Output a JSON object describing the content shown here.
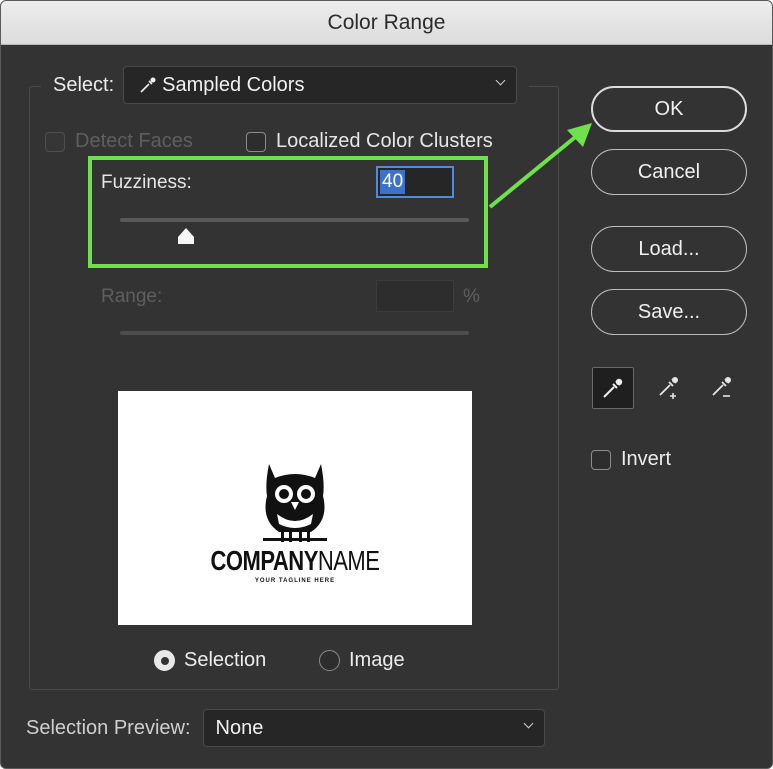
{
  "window": {
    "title": "Color Range"
  },
  "select": {
    "label": "Select:",
    "value": "Sampled Colors"
  },
  "options": {
    "detect_faces": "Detect Faces",
    "localized_clusters": "Localized Color Clusters"
  },
  "fuzziness": {
    "label": "Fuzziness:",
    "value": "40",
    "slider_level": 0.19
  },
  "range": {
    "label": "Range:",
    "value": "",
    "unit": "%"
  },
  "preview": {
    "company_bold": "COMPANY",
    "company_thin": "NAME",
    "tagline": "YOUR TAGLINE HERE"
  },
  "view": {
    "selection": "Selection",
    "image": "Image",
    "selected": "selection"
  },
  "selection_preview": {
    "label": "Selection Preview:",
    "value": "None"
  },
  "buttons": {
    "ok": "OK",
    "cancel": "Cancel",
    "load": "Load...",
    "save": "Save..."
  },
  "tools": [
    "eyedropper-icon",
    "eyedropper-plus-icon",
    "eyedropper-minus-icon"
  ],
  "invert": {
    "label": "Invert",
    "checked": false
  },
  "colors": {
    "highlight": "#6ee14c",
    "field_selection": "#3d73c7"
  }
}
